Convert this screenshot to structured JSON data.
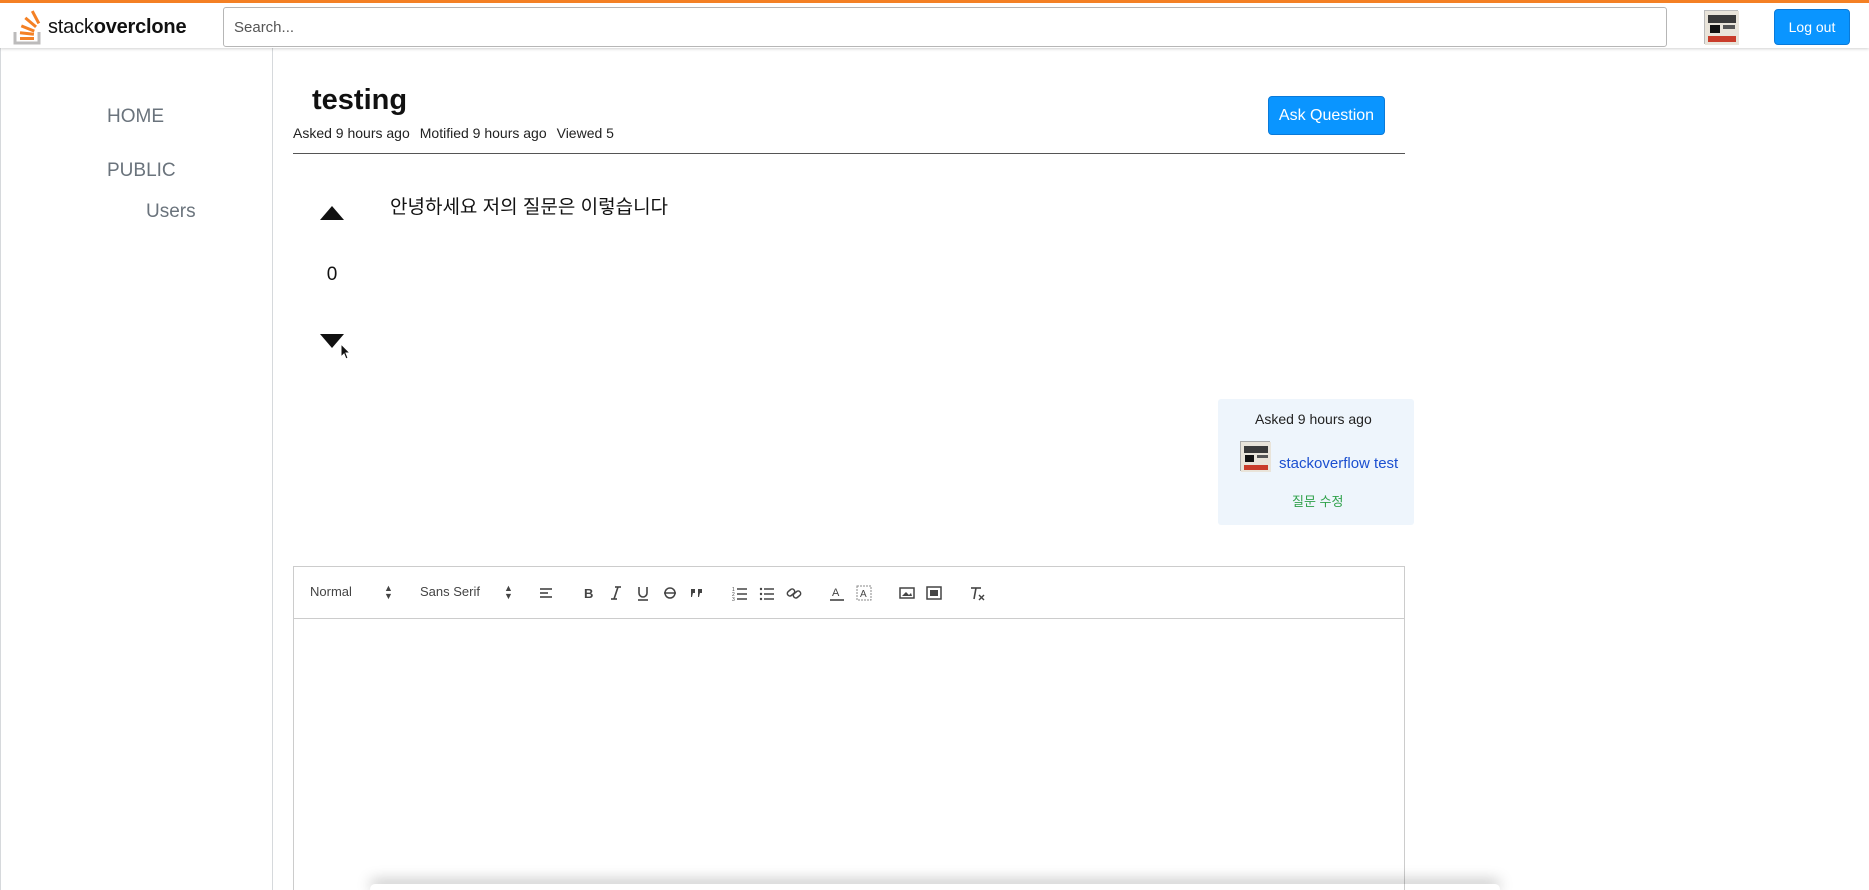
{
  "header": {
    "logo_prefix": "stack",
    "logo_suffix": "overclone",
    "search_placeholder": "Search...",
    "logout_label": "Log out"
  },
  "sidebar": {
    "home": "HOME",
    "public": "PUBLIC",
    "users": "Users"
  },
  "question": {
    "title": "testing",
    "asked": "Asked 9 hours ago",
    "modified": "Motified 9 hours ago",
    "viewed": "Viewed 5",
    "ask_button": "Ask Question",
    "body": "안녕하세요 저의 질문은 이렇습니다",
    "votes": "0"
  },
  "owner": {
    "asked": "Asked 9 hours ago",
    "name": "stackoverflow test",
    "edit_link": "질문 수정"
  },
  "editor": {
    "header_select": "Normal",
    "font_select": "Sans Serif",
    "tools": [
      "align-left-icon",
      "bold-icon",
      "italic-icon",
      "underline-icon",
      "strike-icon",
      "blockquote-icon",
      "ordered-list-icon",
      "bullet-list-icon",
      "link-icon",
      "text-color-icon",
      "background-color-icon",
      "image-icon",
      "video-icon",
      "clear-format-icon"
    ]
  },
  "colors": {
    "accent": "#0a95ff",
    "brand_orange": "#f48024",
    "link": "#1b4fd0",
    "edit_green": "#2fa14a",
    "owner_card_bg": "#eef5fc"
  }
}
